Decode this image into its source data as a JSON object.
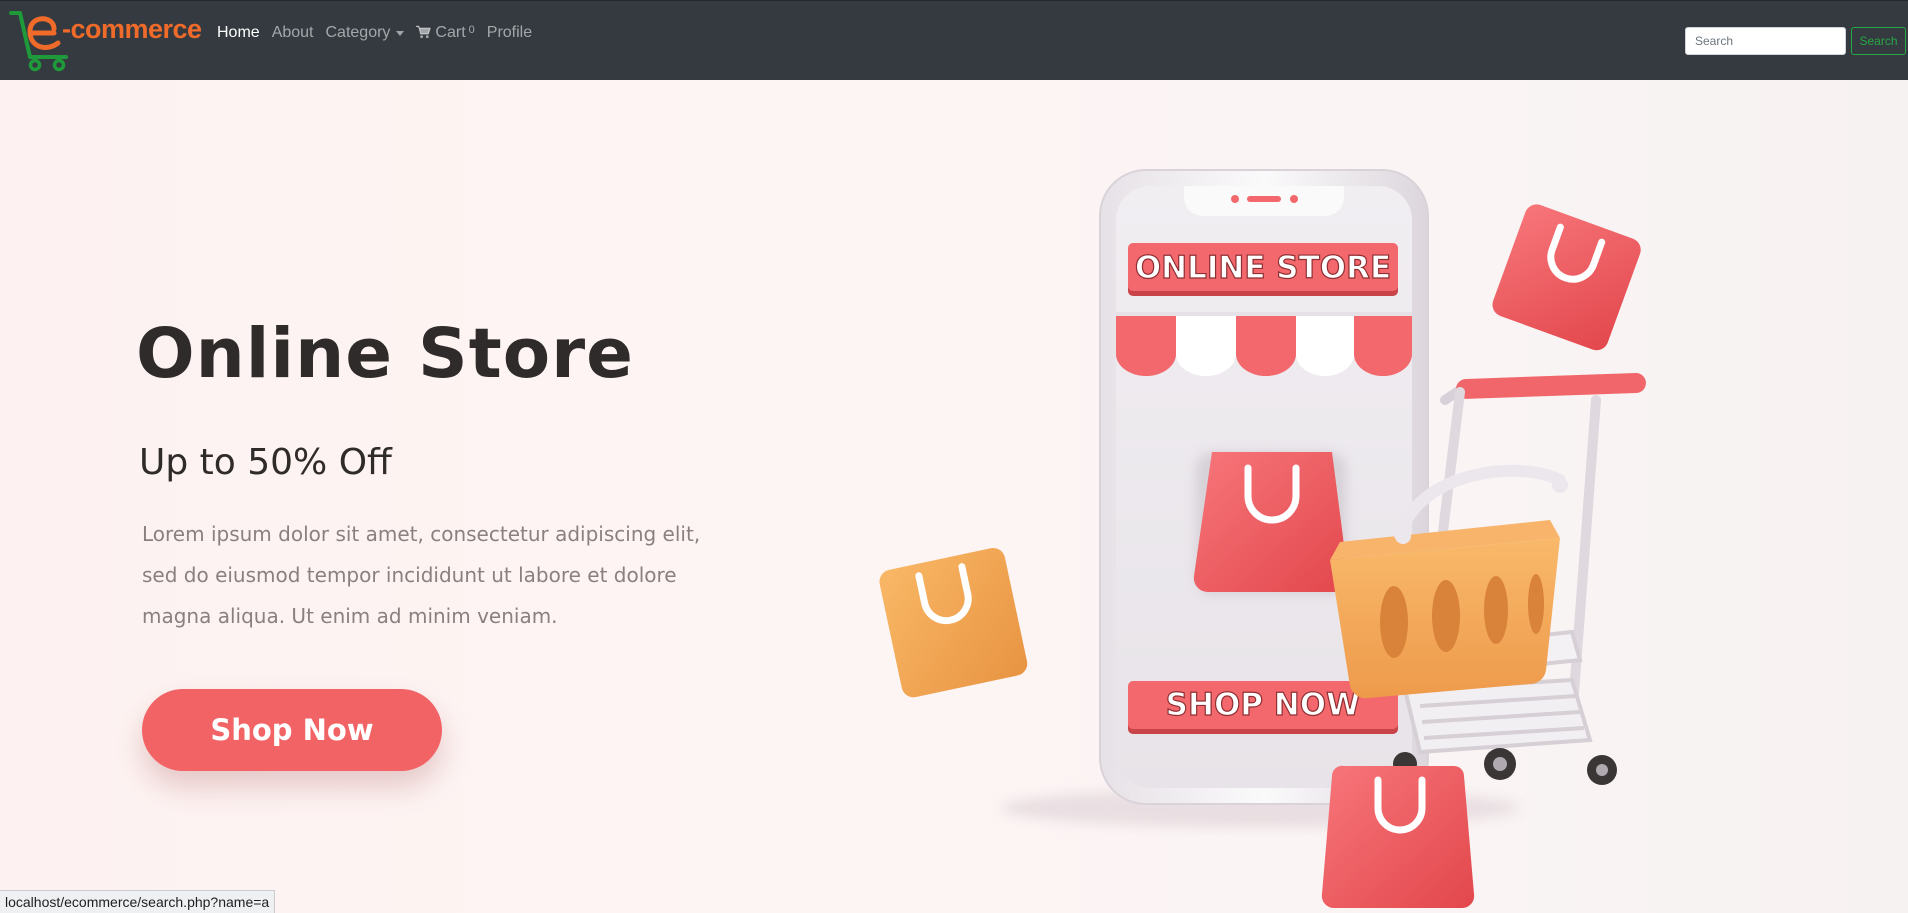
{
  "navbar": {
    "brand": "e-commerce",
    "links": [
      {
        "label": "Home",
        "active": true
      },
      {
        "label": "About"
      },
      {
        "label": "Category",
        "dropdown": true
      },
      {
        "label": "Cart",
        "icon": "shopping-cart-icon",
        "badge": "0"
      },
      {
        "label": "Profile"
      }
    ],
    "search_placeholder": "Search",
    "search_button": "Search"
  },
  "hero": {
    "title": "Online Store",
    "subtitle": "Up to 50% Off",
    "text_lines": [
      "Lorem ipsum dolor sit amet, consectetur adipiscing elit,",
      "sed do eiusmod tempor incididunt ut labore et dolore",
      "magna aliqua. Ut enim ad minim veniam."
    ],
    "cta": "Shop Now",
    "illustration": {
      "sign_top": "ONLINE STORE",
      "sign_bottom": "SHOP NOW"
    }
  },
  "status_bar": "localhost/ecommerce/search.php?name=a",
  "colors": {
    "navbar_bg": "#343a40",
    "brand_orange": "#f06b2a",
    "brand_cart_green": "#1f9a3a",
    "accent_red": "#f26366",
    "basket_orange": "#f5a95b",
    "search_green": "#28a745"
  }
}
